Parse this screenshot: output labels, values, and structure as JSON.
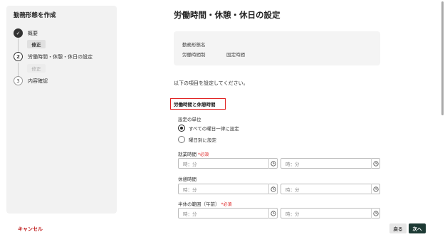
{
  "sidebar": {
    "title": "勤務形態を作成",
    "steps": [
      {
        "number": "✓",
        "label": "概要",
        "state": "done",
        "edit_label": "修正"
      },
      {
        "number": "2",
        "label": "労働時間・休憩・休日の設定",
        "state": "active",
        "edit_label": "修正"
      },
      {
        "number": "3",
        "label": "内容確認",
        "state": "todo"
      }
    ]
  },
  "main": {
    "title": "労働時間・休憩・休日の設定",
    "summary": {
      "name_key": "勤務形態名",
      "name_value": "",
      "system_key": "労働時間制",
      "system_value": "固定時間"
    },
    "instruction": "以下の項目を設定してください。",
    "section_title": "労働時間と休憩時間",
    "unit_label": "設定の単位",
    "radio_options": [
      {
        "label": "すべての曜日一律に設定",
        "checked": true
      },
      {
        "label": "曜日別に設定",
        "checked": false
      }
    ],
    "required_mark": "*必須",
    "work_hours_label": "就業時間",
    "break_label": "休憩時間",
    "half_day_label": "半休の範囲（午前）",
    "time_placeholder": "時：分"
  },
  "footer": {
    "cancel_label": "キャンセル",
    "back_label": "戻る",
    "next_label": "次へ"
  },
  "colors": {
    "accent": "#1d3a34",
    "danger": "#c02020",
    "highlight_border": "#e02020"
  }
}
